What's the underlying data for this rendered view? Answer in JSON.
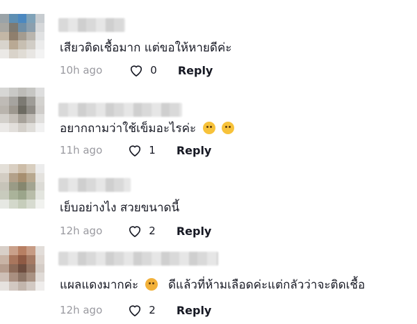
{
  "comments": [
    {
      "text": "เสียวติดเชื้อมาก แต่ขอให้หายดีค่ะ",
      "time": "10h ago",
      "likes": "0",
      "reply": "Reply",
      "avatar_colors": [
        "#9aa3a8",
        "#5e8fb3",
        "#4b88c0",
        "#7fa2b8",
        "#c7ccd0",
        "#a8a7a2",
        "#7d7a72",
        "#6f8fa7",
        "#8b9fae",
        "#d6d8da",
        "#c3b7a6",
        "#8f7f6d",
        "#a49c90",
        "#b9b5ae",
        "#e1e2e3",
        "#d8d4cd",
        "#b9a994",
        "#c7bfb2",
        "#d1cdc6",
        "#ececec",
        "#ebe9e6",
        "#d9d3ca",
        "#e0dcd5",
        "#e8e6e3",
        "#f3f3f3"
      ]
    },
    {
      "text": "อยากถามว่าใช้เข็มอะไรค่ะ",
      "time": "11h ago",
      "likes": "1",
      "reply": "Reply",
      "avatar_colors": [
        "#d7d7d5",
        "#c9c9c6",
        "#bdbcb8",
        "#c6c6c3",
        "#dedede",
        "#bfbbb6",
        "#a6a49f",
        "#7c7a73",
        "#9e9c97",
        "#d3d2cf",
        "#b9b4ad",
        "#9d988f",
        "#6d6b62",
        "#8f8c86",
        "#cfcdca",
        "#d3d0cb",
        "#c5c0b9",
        "#a7a29a",
        "#bebab4",
        "#e0dfdd",
        "#ebe9e7",
        "#e2dfdb",
        "#d4d0ca",
        "#dfddd9",
        "#f1f1f1"
      ]
    },
    {
      "text": "เย็บอย่างไง สวยขนาดนี้",
      "time": "12h ago",
      "likes": "2",
      "reply": "Reply",
      "avatar_colors": [
        "#e3dfd8",
        "#d9cfc2",
        "#cdbda8",
        "#d8cebf",
        "#ececec",
        "#d3cdc3",
        "#b3a18a",
        "#a78f70",
        "#b8a88f",
        "#e4e2de",
        "#c7c4b9",
        "#9a9b86",
        "#86876f",
        "#a3a491",
        "#dcdbd6",
        "#c8cbbd",
        "#aab39a",
        "#9ba58b",
        "#b8bda9",
        "#e3e5df",
        "#e6e8e3",
        "#d3d8cb",
        "#c6cdbb",
        "#d7dbd0",
        "#f1f2ef"
      ]
    },
    {
      "text": "แผลแดงมากค่ะ",
      "text2": "ดีแล้วที่ห้ามเลือดค่ะแต่กลัวว่าจะติดเชื้อ",
      "time": "12h ago",
      "likes": "2",
      "reply": "Reply",
      "avatar_colors": [
        "#d8cfc8",
        "#c9a08a",
        "#b77f63",
        "#c69b84",
        "#e2ddd9",
        "#c8b3a5",
        "#a9765d",
        "#8f5a44",
        "#a57a64",
        "#ddd5cf",
        "#b59c8d",
        "#8c6a58",
        "#6e4d3f",
        "#937463",
        "#d4ccc6",
        "#cdbfb6",
        "#a98f80",
        "#8d7566",
        "#a99283",
        "#e0dbd7",
        "#e6e2df",
        "#d2c8c1",
        "#c2b5ac",
        "#d2c9c3",
        "#efedec"
      ]
    }
  ]
}
